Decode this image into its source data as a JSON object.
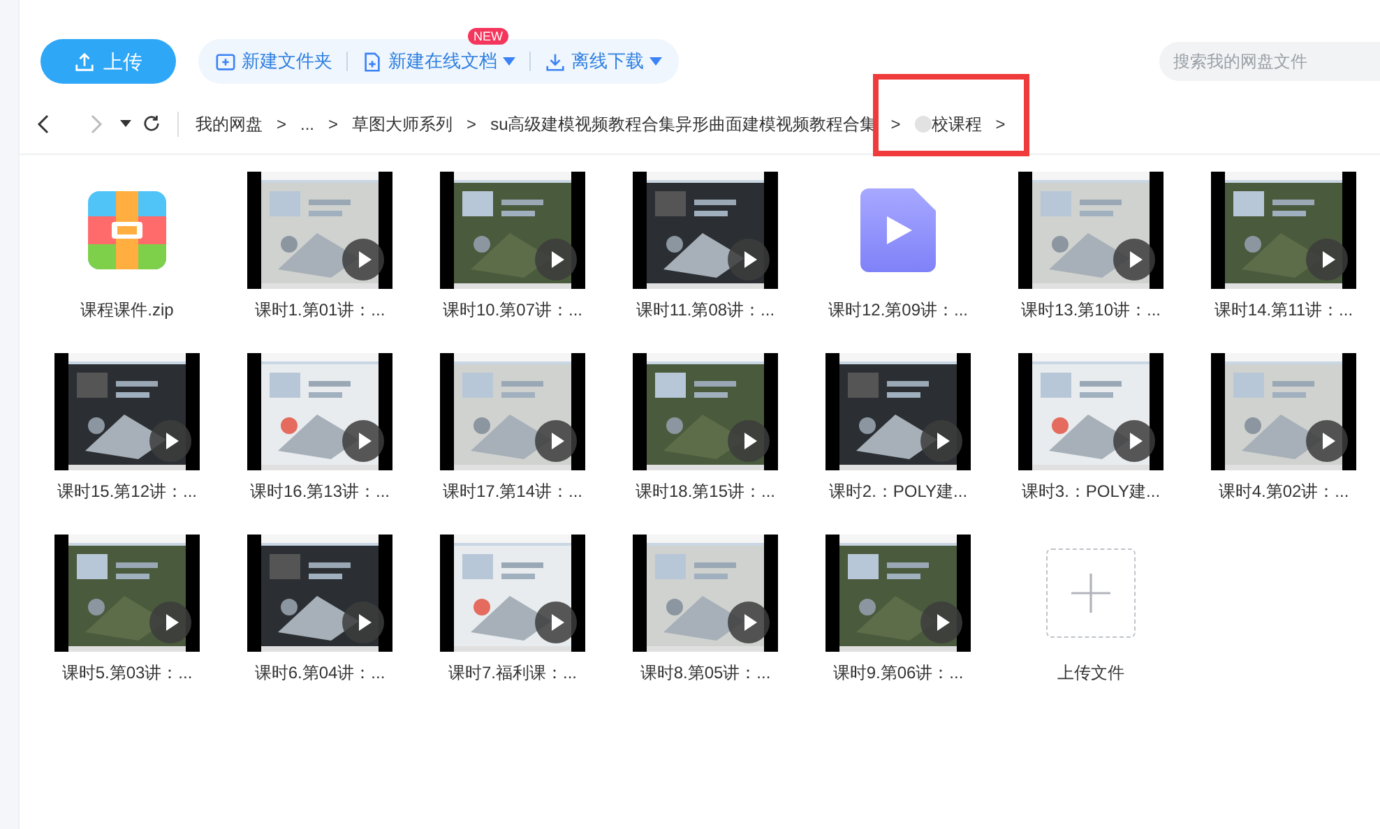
{
  "toolbar": {
    "upload": "上传",
    "actions": [
      {
        "label": "新建文件夹",
        "kind": "folder"
      },
      {
        "label": "新建在线文档",
        "kind": "doc",
        "badge": "NEW",
        "dropdown": true
      },
      {
        "label": "离线下载",
        "kind": "download",
        "dropdown": true
      }
    ],
    "search": {
      "placeholder": "搜索我的网盘文件"
    }
  },
  "breadcrumb": [
    {
      "label": "我的网盘",
      "separator": ">"
    },
    {
      "label": "...",
      "separator": ">"
    },
    {
      "label": "草图大师系列",
      "separator": ">"
    },
    {
      "label": "su高级建模视频教程合集异形曲面建模视频教程合集",
      "separator": ">"
    },
    {
      "label": "校课程",
      "separator": ">",
      "blurred": true,
      "highlighted": true
    }
  ],
  "files": [
    {
      "name": "课程课件.zip",
      "kind": "zip"
    },
    {
      "name": "课时1.第01讲：...",
      "kind": "video"
    },
    {
      "name": "课时10.第07讲：...",
      "kind": "video"
    },
    {
      "name": "课时11.第08讲：...",
      "kind": "video"
    },
    {
      "name": "课时12.第09讲：...",
      "kind": "videofile"
    },
    {
      "name": "课时13.第10讲：...",
      "kind": "video"
    },
    {
      "name": "课时14.第11讲：...",
      "kind": "video"
    },
    {
      "name": "课时15.第12讲：...",
      "kind": "video"
    },
    {
      "name": "课时16.第13讲：...",
      "kind": "video"
    },
    {
      "name": "课时17.第14讲：...",
      "kind": "video"
    },
    {
      "name": "课时18.第15讲：...",
      "kind": "video"
    },
    {
      "name": "课时2.：POLY建...",
      "kind": "video"
    },
    {
      "name": "课时3.：POLY建...",
      "kind": "video"
    },
    {
      "name": "课时4.第02讲：...",
      "kind": "video"
    },
    {
      "name": "课时5.第03讲：...",
      "kind": "video"
    },
    {
      "name": "课时6.第04讲：...",
      "kind": "video"
    },
    {
      "name": "课时7.福利课：...",
      "kind": "video"
    },
    {
      "name": "课时8.第05讲：...",
      "kind": "video"
    },
    {
      "name": "课时9.第06讲：...",
      "kind": "video"
    },
    {
      "name": "上传文件",
      "kind": "upload"
    }
  ]
}
